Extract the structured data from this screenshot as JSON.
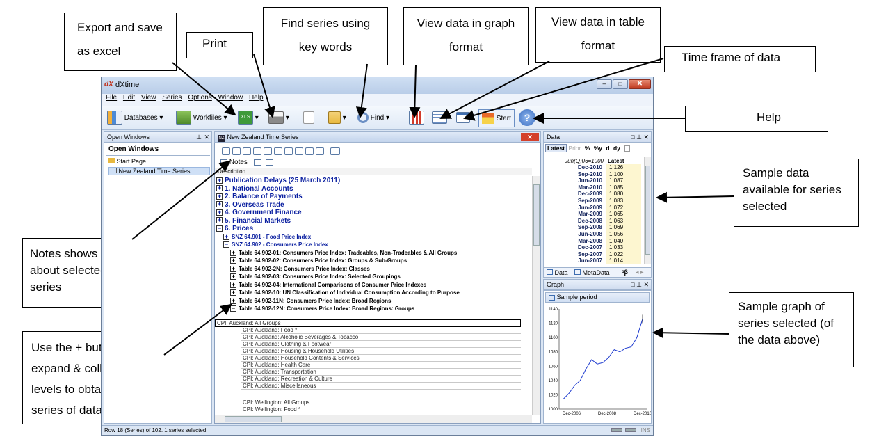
{
  "callouts": {
    "export": "Export and save as excel",
    "print": "Print",
    "find": "Find series using key words",
    "graph": "View data in graph format",
    "table": "View data in table format",
    "timeframe": "Time frame of data",
    "help": "Help",
    "sample_data": "Sample data available for series selected",
    "notes": "Notes shows info about selected series",
    "expand": "Use the + buttons to expand & collapse the levels to obtain the series of data",
    "sample_graph": "Sample graph of series selected (of the data above)"
  },
  "window": {
    "title": "dXtime",
    "menu": [
      "File",
      "Edit",
      "View",
      "Series",
      "Options",
      "Window",
      "Help"
    ]
  },
  "toolbar": {
    "databases": "Databases",
    "workfiles": "Workfiles",
    "xls": "XLS",
    "find": "Find",
    "start": "Start"
  },
  "open_windows": {
    "header": "Open Windows",
    "title": "Open Windows",
    "items": [
      "Start Page",
      "New Zealand Time Series"
    ]
  },
  "series_pane": {
    "header": "New Zealand Time Series",
    "notes": "Notes",
    "column": "Description",
    "top_nodes": [
      {
        "sign": "+",
        "label": "Publication Delays (25 March 2011)"
      },
      {
        "sign": "+",
        "label": "1.   National Accounts"
      },
      {
        "sign": "+",
        "label": "2.   Balance of Payments"
      },
      {
        "sign": "+",
        "label": "3.   Overseas Trade"
      },
      {
        "sign": "+",
        "label": "4.   Government Finance"
      },
      {
        "sign": "+",
        "label": "5.   Financial Markets"
      },
      {
        "sign": "−",
        "label": "6.   Prices"
      }
    ],
    "sub_nodes": [
      {
        "sign": "+",
        "label": "SNZ 64.901 - Food Price Index"
      },
      {
        "sign": "−",
        "label": "SNZ 64.902 - Consumers Price Index"
      }
    ],
    "tables": [
      {
        "sign": "+",
        "label": "Table 64.902-01: Consumers Price Index: Tradeables, Non-Tradeables & All Groups"
      },
      {
        "sign": "+",
        "label": "Table 64.902-02: Consumers Price Index: Groups & Sub-Groups"
      },
      {
        "sign": "+",
        "label": "Table 64.902-2N: Consumers Price Index: Classes"
      },
      {
        "sign": "+",
        "label": "Table 64.902-03: Consumers Price Index: Selected Groupings"
      },
      {
        "sign": "+",
        "label": "Table 64.902-04: International Comparisons of Consumer Price Indexes"
      },
      {
        "sign": "+",
        "label": "Table 64.902-10: UN Classification of Individual Consumption According to Purpose"
      },
      {
        "sign": "+",
        "label": "Table 64.902-11N: Consumers Price Index: Broad Regions"
      },
      {
        "sign": "−",
        "label": "Table 64.902-12N: Consumers Price Index: Broad Regions: Groups"
      }
    ],
    "leaves": [
      "CPI: Auckland: All Groups",
      "CPI: Auckland: Food *",
      "CPI: Auckland: Alcoholic Beverages & Tobacco",
      "CPI: Auckland: Clothing & Footwear",
      "CPI: Auckland: Housing & Household Utilities",
      "CPI: Auckland: Household Contents & Services",
      "CPI: Auckland: Health Care",
      "CPI: Auckland: Transportation",
      "CPI: Auckland: Recreation & Culture",
      "CPI: Auckland: Miscellaneous",
      "",
      "CPI: Wellington: All Groups",
      "CPI: Wellington: Food *"
    ]
  },
  "data_pane": {
    "header": "Data",
    "tabs": [
      "Latest",
      "Prior",
      "%",
      "%y",
      "d",
      "dy"
    ],
    "unit": "Jun(Q)06=1000",
    "col": "Latest",
    "rows": [
      {
        "date": "Dec-2010",
        "value": "1,126"
      },
      {
        "date": "Sep-2010",
        "value": "1,100"
      },
      {
        "date": "Jun-2010",
        "value": "1,087"
      },
      {
        "date": "Mar-2010",
        "value": "1,085"
      },
      {
        "date": "Dec-2009",
        "value": "1,080"
      },
      {
        "date": "Sep-2009",
        "value": "1,083"
      },
      {
        "date": "Jun-2009",
        "value": "1,072"
      },
      {
        "date": "Mar-2009",
        "value": "1,065"
      },
      {
        "date": "Dec-2008",
        "value": "1,063"
      },
      {
        "date": "Sep-2008",
        "value": "1,069"
      },
      {
        "date": "Jun-2008",
        "value": "1,056"
      },
      {
        "date": "Mar-2008",
        "value": "1,040"
      },
      {
        "date": "Dec-2007",
        "value": "1,033"
      },
      {
        "date": "Sep-2007",
        "value": "1,022"
      },
      {
        "date": "Jun-2007",
        "value": "1,014"
      }
    ],
    "bottom_tabs": [
      "Data",
      "MetaData"
    ]
  },
  "graph_pane": {
    "header": "Graph",
    "button": "Sample period",
    "y_ticks": [
      "1140",
      "1120",
      "1100",
      "1080",
      "1060",
      "1040",
      "1020",
      "1000"
    ],
    "x_ticks": [
      "Dec-2006",
      "Dec-2008",
      "Dec-2010"
    ]
  },
  "statusbar": {
    "text": "Row 18 (Series) of 102.  1 series selected.",
    "ins": "INS"
  },
  "colors": {
    "accent": "#0a1fa0",
    "line": "#1f3ccf"
  }
}
